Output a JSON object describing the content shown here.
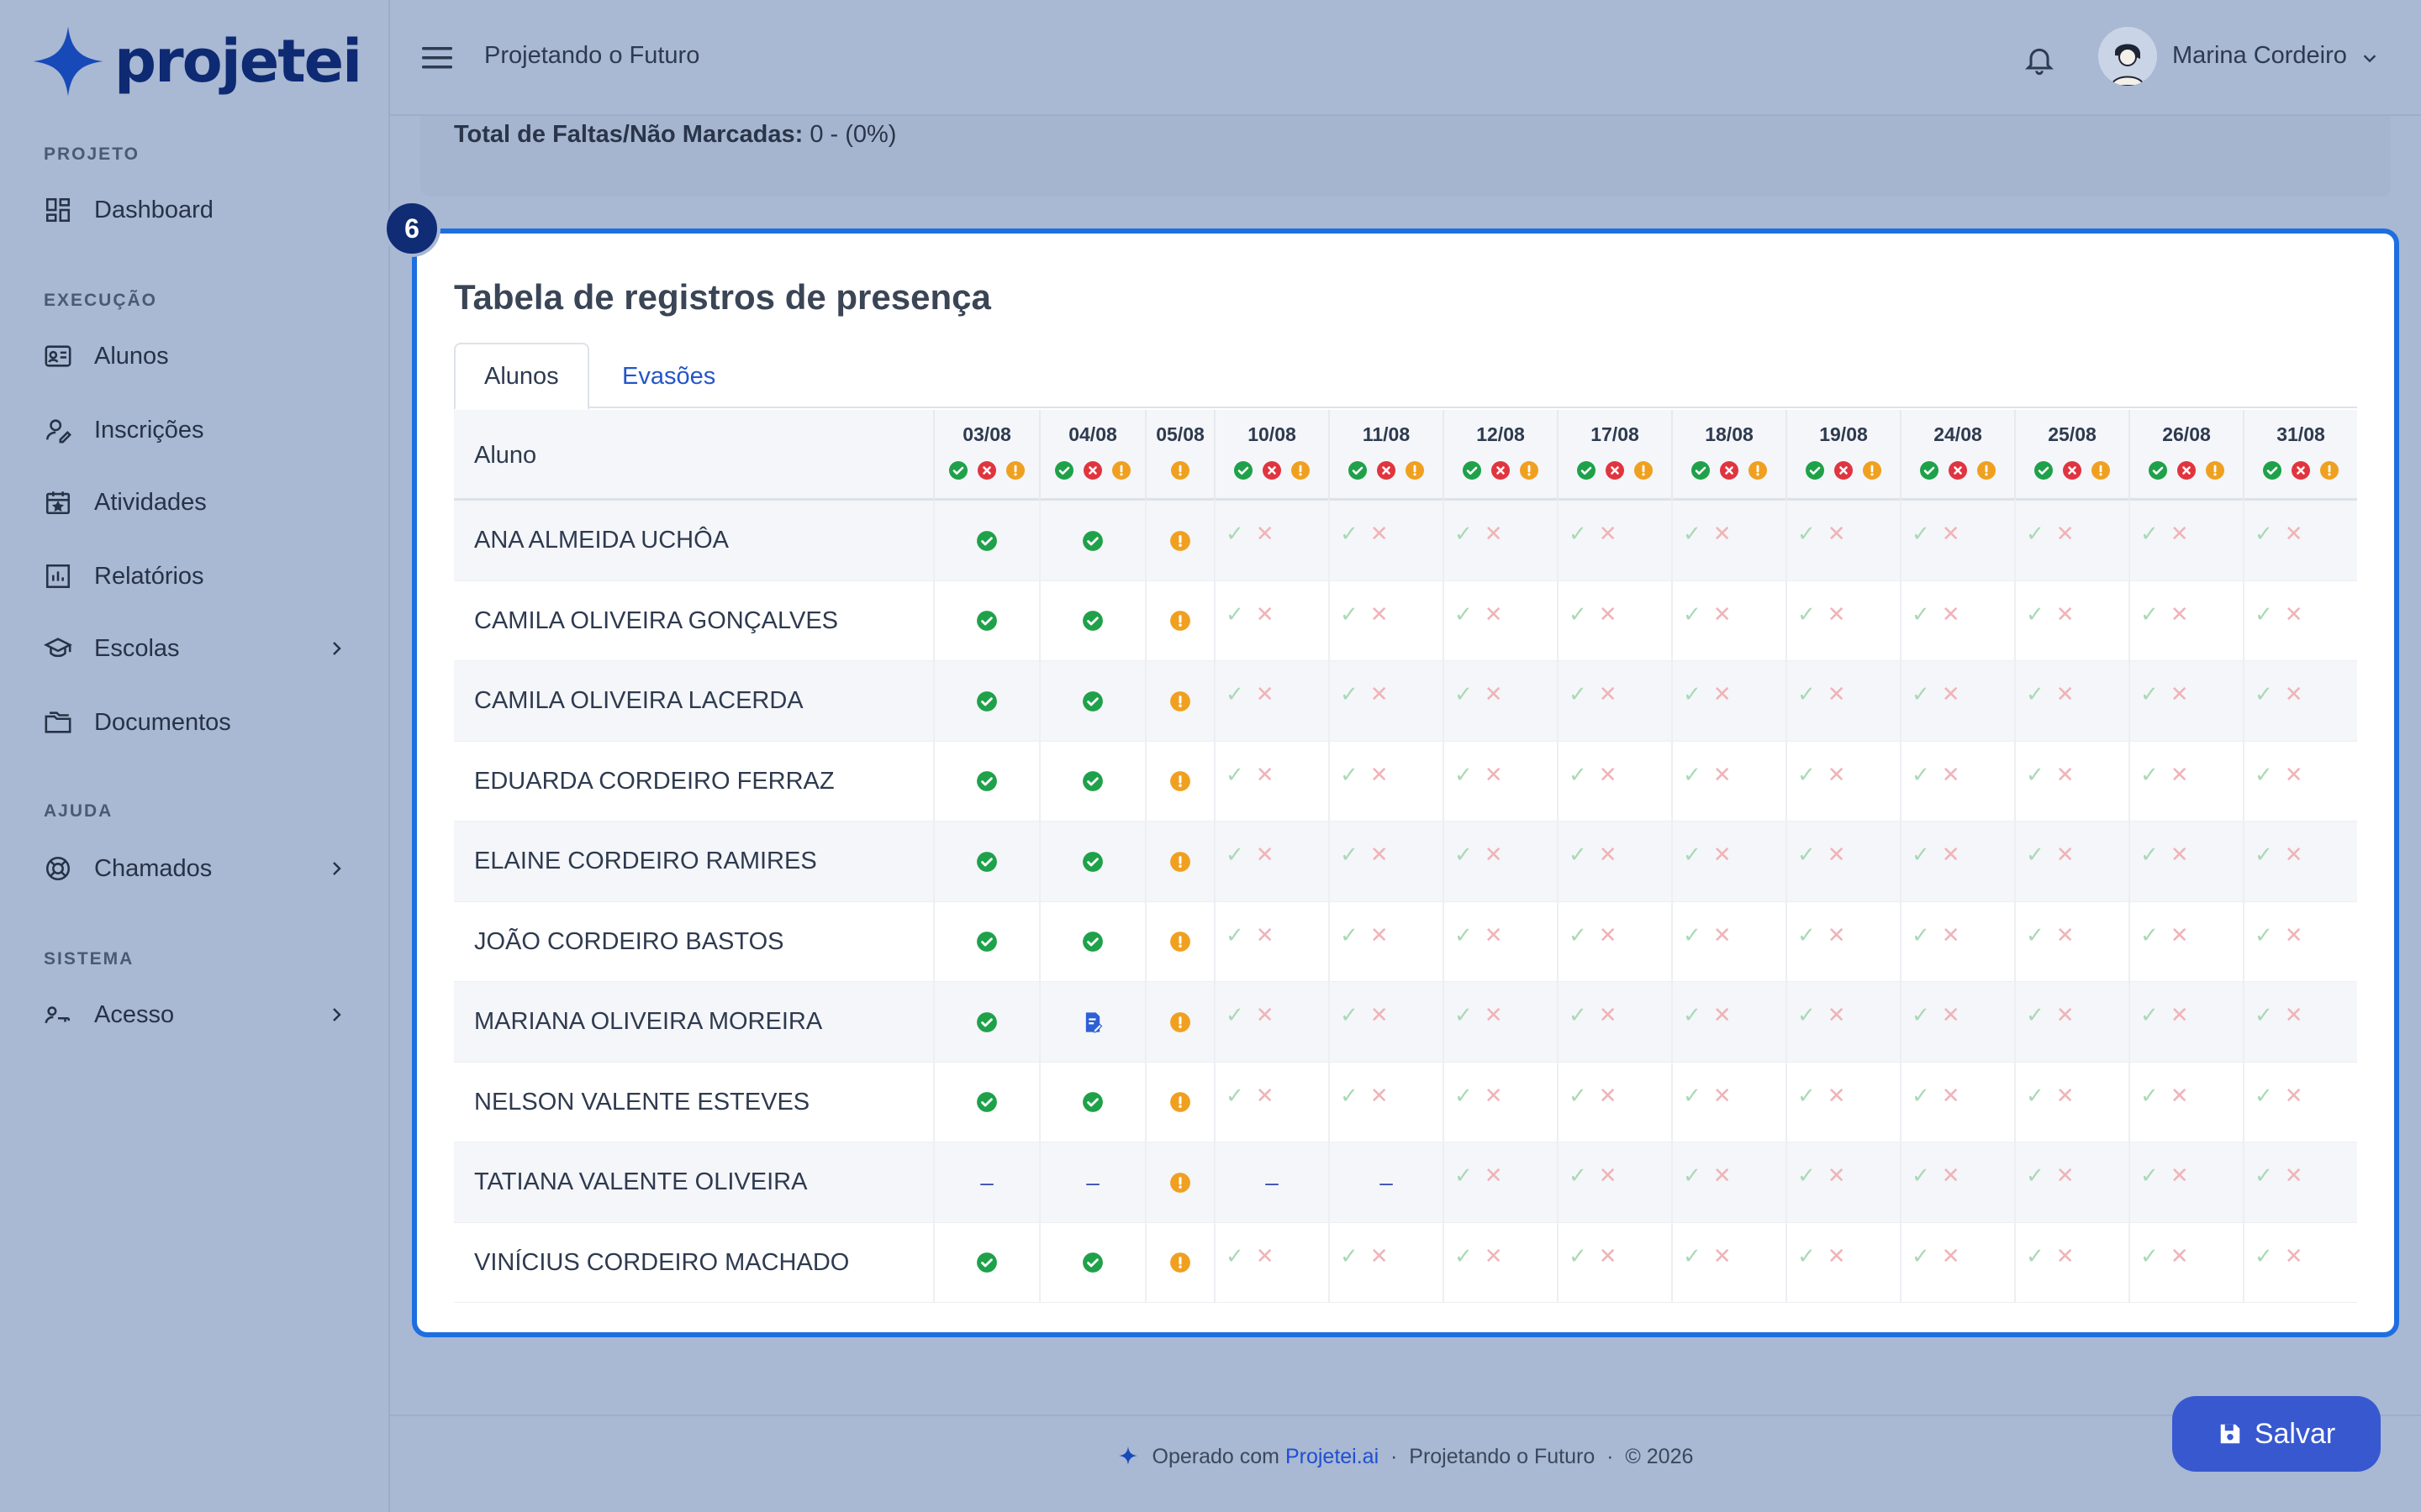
{
  "brand": {
    "name": "projetei"
  },
  "sidebar": {
    "sections": [
      {
        "title": "PROJETO",
        "items": [
          {
            "label": "Dashboard",
            "icon": "dashboard-icon"
          }
        ]
      },
      {
        "title": "EXECUÇÃO",
        "items": [
          {
            "label": "Alunos",
            "icon": "id-card-icon"
          },
          {
            "label": "Inscrições",
            "icon": "user-edit-icon"
          },
          {
            "label": "Atividades",
            "icon": "calendar-icon"
          },
          {
            "label": "Relatórios",
            "icon": "chart-icon"
          },
          {
            "label": "Escolas",
            "icon": "graduation-cap-icon",
            "expandable": true
          },
          {
            "label": "Documentos",
            "icon": "folder-icon"
          }
        ]
      },
      {
        "title": "AJUDA",
        "items": [
          {
            "label": "Chamados",
            "icon": "lifebuoy-icon",
            "expandable": true
          }
        ]
      },
      {
        "title": "SISTEMA",
        "items": [
          {
            "label": "Acesso",
            "icon": "user-key-icon",
            "expandable": true
          }
        ]
      }
    ]
  },
  "topbar": {
    "project": "Projetando o Futuro",
    "user": "Marina Cordeiro"
  },
  "summary": {
    "label": "Total de Faltas/Não Marcadas:",
    "value": "0 - (0%)"
  },
  "card": {
    "step": "6",
    "title": "Tabela de registros de presença",
    "tabs": [
      {
        "label": "Alunos",
        "active": true
      },
      {
        "label": "Evasões",
        "active": false
      }
    ]
  },
  "table": {
    "name_header": "Aluno",
    "dates": [
      "03/08",
      "04/08",
      "05/08",
      "10/08",
      "11/08",
      "12/08",
      "17/08",
      "18/08",
      "19/08",
      "24/08",
      "25/08",
      "26/08",
      "31/08"
    ],
    "date_header_icons": [
      "full",
      "full",
      "warn",
      "full",
      "full",
      "full",
      "full",
      "full",
      "full",
      "full",
      "full",
      "full",
      "full"
    ],
    "rows": [
      {
        "name": "ANA ALMEIDA UCHÔA",
        "cells": [
          "present",
          "present",
          "warn",
          "pair",
          "pair",
          "pair",
          "pair",
          "pair",
          "pair",
          "pair",
          "pair",
          "pair",
          "pair"
        ]
      },
      {
        "name": "CAMILA OLIVEIRA GONÇALVES",
        "cells": [
          "present",
          "present",
          "warn",
          "pair",
          "pair",
          "pair",
          "pair",
          "pair",
          "pair",
          "pair",
          "pair",
          "pair",
          "pair"
        ]
      },
      {
        "name": "CAMILA OLIVEIRA LACERDA",
        "cells": [
          "present",
          "present",
          "warn",
          "pair",
          "pair",
          "pair",
          "pair",
          "pair",
          "pair",
          "pair",
          "pair",
          "pair",
          "pair"
        ]
      },
      {
        "name": "EDUARDA CORDEIRO FERRAZ",
        "cells": [
          "present",
          "present",
          "warn",
          "pair",
          "pair",
          "pair",
          "pair",
          "pair",
          "pair",
          "pair",
          "pair",
          "pair",
          "pair"
        ]
      },
      {
        "name": "ELAINE CORDEIRO RAMIRES",
        "cells": [
          "present",
          "present",
          "warn",
          "pair",
          "pair",
          "pair",
          "pair",
          "pair",
          "pair",
          "pair",
          "pair",
          "pair",
          "pair"
        ]
      },
      {
        "name": "JOÃO CORDEIRO BASTOS",
        "cells": [
          "present",
          "present",
          "warn",
          "pair",
          "pair",
          "pair",
          "pair",
          "pair",
          "pair",
          "pair",
          "pair",
          "pair",
          "pair"
        ]
      },
      {
        "name": "MARIANA OLIVEIRA MOREIRA",
        "cells": [
          "present",
          "justified",
          "warn",
          "pair",
          "pair",
          "pair",
          "pair",
          "pair",
          "pair",
          "pair",
          "pair",
          "pair",
          "pair"
        ]
      },
      {
        "name": "NELSON VALENTE ESTEVES",
        "cells": [
          "present",
          "present",
          "warn",
          "pair",
          "pair",
          "pair",
          "pair",
          "pair",
          "pair",
          "pair",
          "pair",
          "pair",
          "pair"
        ]
      },
      {
        "name": "TATIANA VALENTE OLIVEIRA",
        "cells": [
          "dash",
          "dash",
          "warn",
          "dash",
          "dash",
          "pair",
          "pair",
          "pair",
          "pair",
          "pair",
          "pair",
          "pair",
          "pair"
        ]
      },
      {
        "name": "VINÍCIUS CORDEIRO MACHADO",
        "cells": [
          "present",
          "present",
          "warn",
          "pair",
          "pair",
          "pair",
          "pair",
          "pair",
          "pair",
          "pair",
          "pair",
          "pair",
          "pair"
        ]
      }
    ],
    "marks": {
      "ok": "✓",
      "no": "✕",
      "dash": "–"
    }
  },
  "footer": {
    "prefix": "Operado com",
    "link": "Projetei.ai",
    "sep": "·",
    "project": "Projetando o Futuro",
    "copyright": "© 2026"
  },
  "save_button": {
    "label": "Salvar"
  },
  "colors": {
    "accent": "#1d6fe0",
    "present": "#1fa14a",
    "absent": "#e0353f",
    "warn": "#f0a020",
    "justified": "#2d5fd6"
  }
}
